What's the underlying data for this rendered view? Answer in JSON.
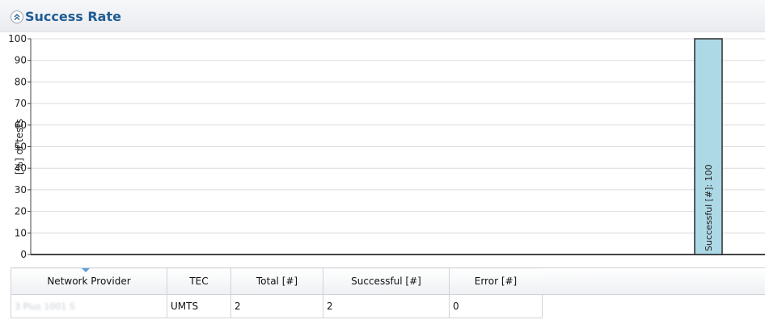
{
  "panel": {
    "title": "Success Rate"
  },
  "chart_data": {
    "type": "bar",
    "ylabel": "[%] of tests",
    "ylim": [
      0,
      100
    ],
    "yticks": [
      0,
      10,
      20,
      30,
      40,
      50,
      60,
      70,
      80,
      90,
      100
    ],
    "grid": true,
    "series": [
      {
        "name": "Successful [#]",
        "values": [
          100
        ],
        "label": "Successful [#]: 100",
        "color": "#add8e6"
      }
    ]
  },
  "table": {
    "columns": [
      "Network Provider",
      "TEC",
      "Total [#]",
      "Successful [#]",
      "Error [#]"
    ],
    "rows": [
      [
        "3 Plus 1001 S",
        "UMTS",
        "2",
        "2",
        "0"
      ]
    ]
  },
  "colors": {
    "title": "#1f5c94",
    "bar_fill": "#add8e6",
    "bar_stroke": "#2b2b2b",
    "grid": "#dcdcdc"
  }
}
